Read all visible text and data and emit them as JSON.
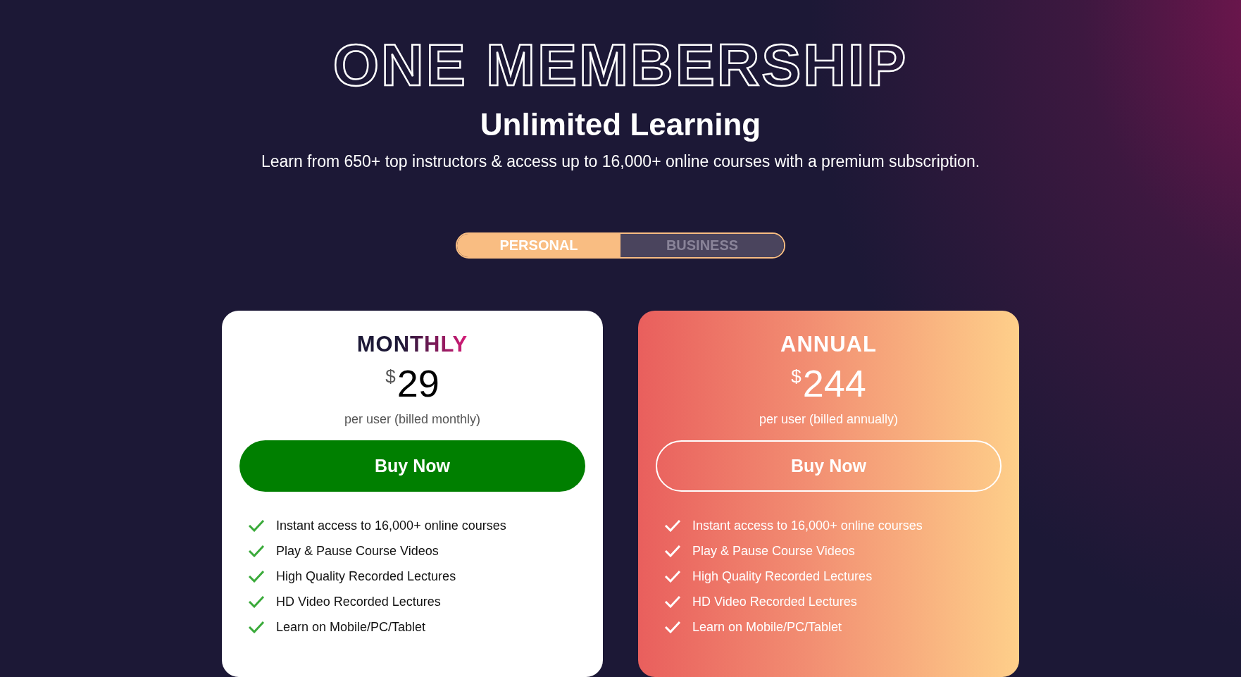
{
  "header": {
    "title": "ONE MEMBERSHIP",
    "subtitle": "Unlimited Learning",
    "description": "Learn from 650+ top instructors & access up to 16,000+ online courses with a premium subscription."
  },
  "plan_toggle": [
    {
      "label": "PERSONAL",
      "selected": true
    },
    {
      "label": "BUSINESS",
      "selected": false
    }
  ],
  "plans": [
    {
      "kind": "light",
      "name": "MONTHLY",
      "currency": "$",
      "price": "29",
      "billing": "per user (billed monthly)",
      "button": "Buy Now",
      "features": [
        "Instant access to 16,000+ online courses",
        "Play & Pause Course Videos",
        "High Quality Recorded Lectures",
        "HD Video Recorded Lectures",
        "Learn on Mobile/PC/Tablet"
      ]
    },
    {
      "kind": "gradient",
      "name": "ANNUAL",
      "currency": "$",
      "price": "244",
      "billing": "per user (billed annually)",
      "button": "Buy Now",
      "features": [
        "Instant access to 16,000+ online courses",
        "Play & Pause Course Videos",
        "High Quality Recorded Lectures",
        "HD Video Recorded Lectures",
        "Learn on Mobile/PC/Tablet"
      ]
    }
  ]
}
